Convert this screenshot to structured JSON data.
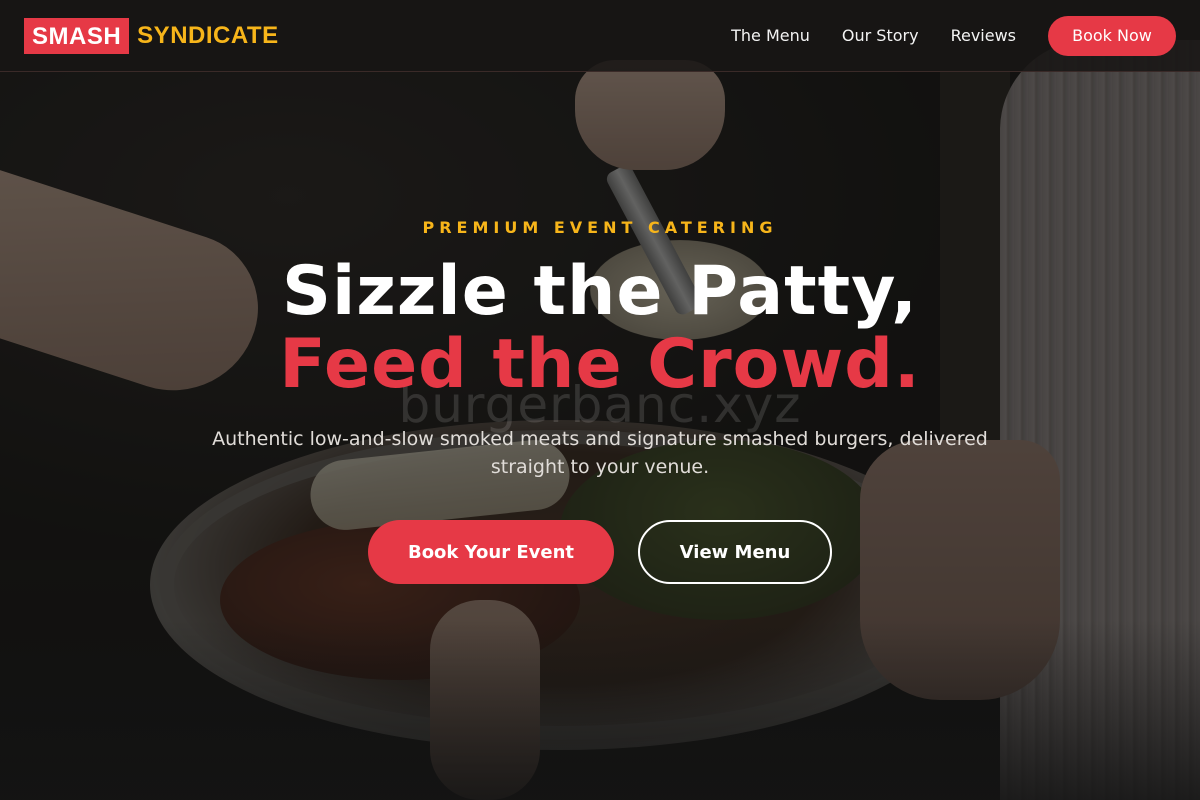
{
  "brand": {
    "logo_box": "SMASH",
    "logo_text": "SYNDICATE",
    "colors": {
      "accent_red": "#e63946",
      "accent_yellow": "#f7b51a",
      "dark_bg": "#181615"
    }
  },
  "nav": {
    "links": [
      "The Menu",
      "Our Story",
      "Reviews"
    ],
    "cta": "Book Now"
  },
  "hero": {
    "eyebrow": "PREMIUM EVENT CATERING",
    "headline_line1": "Sizzle the Patty,",
    "headline_line2": "Feed the Crowd.",
    "watermark": "burgerbanc.xyz",
    "subtitle": "Authentic low-and-slow smoked meats and signature smashed burgers, delivered straight to your venue.",
    "primary_button": "Book Your Event",
    "secondary_button": "View Menu"
  }
}
